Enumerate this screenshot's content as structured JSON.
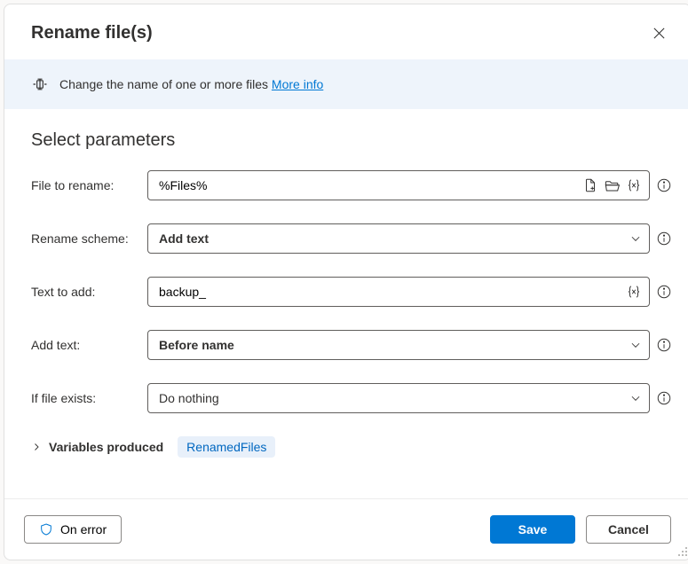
{
  "dialog": {
    "title": "Rename file(s)"
  },
  "banner": {
    "text": "Change the name of one or more files ",
    "link": "More info"
  },
  "section": {
    "title": "Select parameters"
  },
  "form": {
    "file_to_rename": {
      "label": "File to rename:",
      "value": "%Files%"
    },
    "rename_scheme": {
      "label": "Rename scheme:",
      "value": "Add text"
    },
    "text_to_add": {
      "label": "Text to add:",
      "value": "backup_"
    },
    "add_text": {
      "label": "Add text:",
      "value": "Before name"
    },
    "if_file_exists": {
      "label": "If file exists:",
      "value": "Do nothing"
    }
  },
  "variables": {
    "label": "Variables produced",
    "chip": "RenamedFiles"
  },
  "footer": {
    "on_error": "On error",
    "save": "Save",
    "cancel": "Cancel"
  }
}
